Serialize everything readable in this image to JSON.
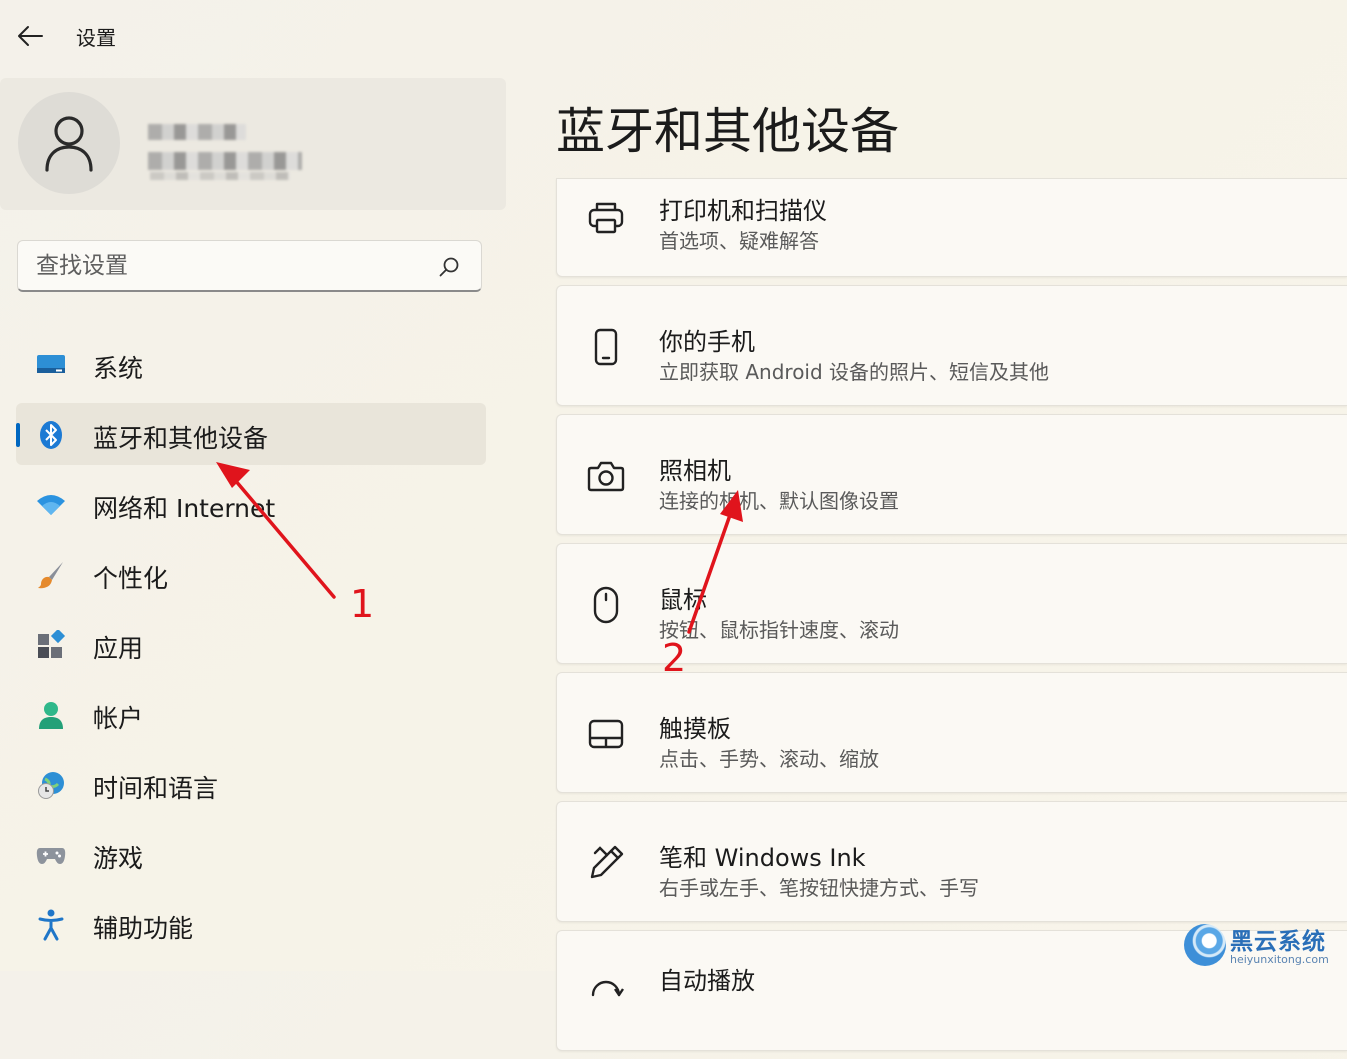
{
  "window": {
    "title": "设置",
    "back_icon": "back-arrow-icon"
  },
  "account": {
    "avatar_icon": "person-icon"
  },
  "search": {
    "placeholder": "查找设置",
    "icon": "search-icon"
  },
  "nav": {
    "items": [
      {
        "label": "系统",
        "icon": "monitor-icon"
      },
      {
        "label": "蓝牙和其他设备",
        "icon": "bluetooth-icon",
        "active": true
      },
      {
        "label": "网络和 Internet",
        "icon": "wifi-icon"
      },
      {
        "label": "个性化",
        "icon": "brush-icon"
      },
      {
        "label": "应用",
        "icon": "apps-icon"
      },
      {
        "label": "帐户",
        "icon": "account-icon"
      },
      {
        "label": "时间和语言",
        "icon": "globe-clock-icon"
      },
      {
        "label": "游戏",
        "icon": "gamepad-icon"
      },
      {
        "label": "辅助功能",
        "icon": "accessibility-icon"
      }
    ]
  },
  "main": {
    "title": "蓝牙和其他设备",
    "cards": [
      {
        "title": "打印机和扫描仪",
        "subtitle": "首选项、疑难解答",
        "icon": "printer-icon"
      },
      {
        "title": "你的手机",
        "subtitle": "立即获取 Android 设备的照片、短信及其他",
        "icon": "phone-icon"
      },
      {
        "title": "照相机",
        "subtitle": "连接的相机、默认图像设置",
        "icon": "camera-icon"
      },
      {
        "title": "鼠标",
        "subtitle": "按钮、鼠标指针速度、滚动",
        "icon": "mouse-icon"
      },
      {
        "title": "触摸板",
        "subtitle": "点击、手势、滚动、缩放",
        "icon": "touchpad-icon"
      },
      {
        "title": "笔和 Windows Ink",
        "subtitle": "右手或左手、笔按钮快捷方式、手写",
        "icon": "pen-icon"
      },
      {
        "title": "自动播放",
        "subtitle": "",
        "icon": "autoplay-icon"
      }
    ]
  },
  "annotations": {
    "arrow1_label": "1",
    "arrow2_label": "2",
    "color": "#e0141c"
  },
  "watermark": {
    "name": "黑云系统",
    "url": "heiyunxitong.com"
  },
  "colors": {
    "accent": "#0067c0"
  }
}
